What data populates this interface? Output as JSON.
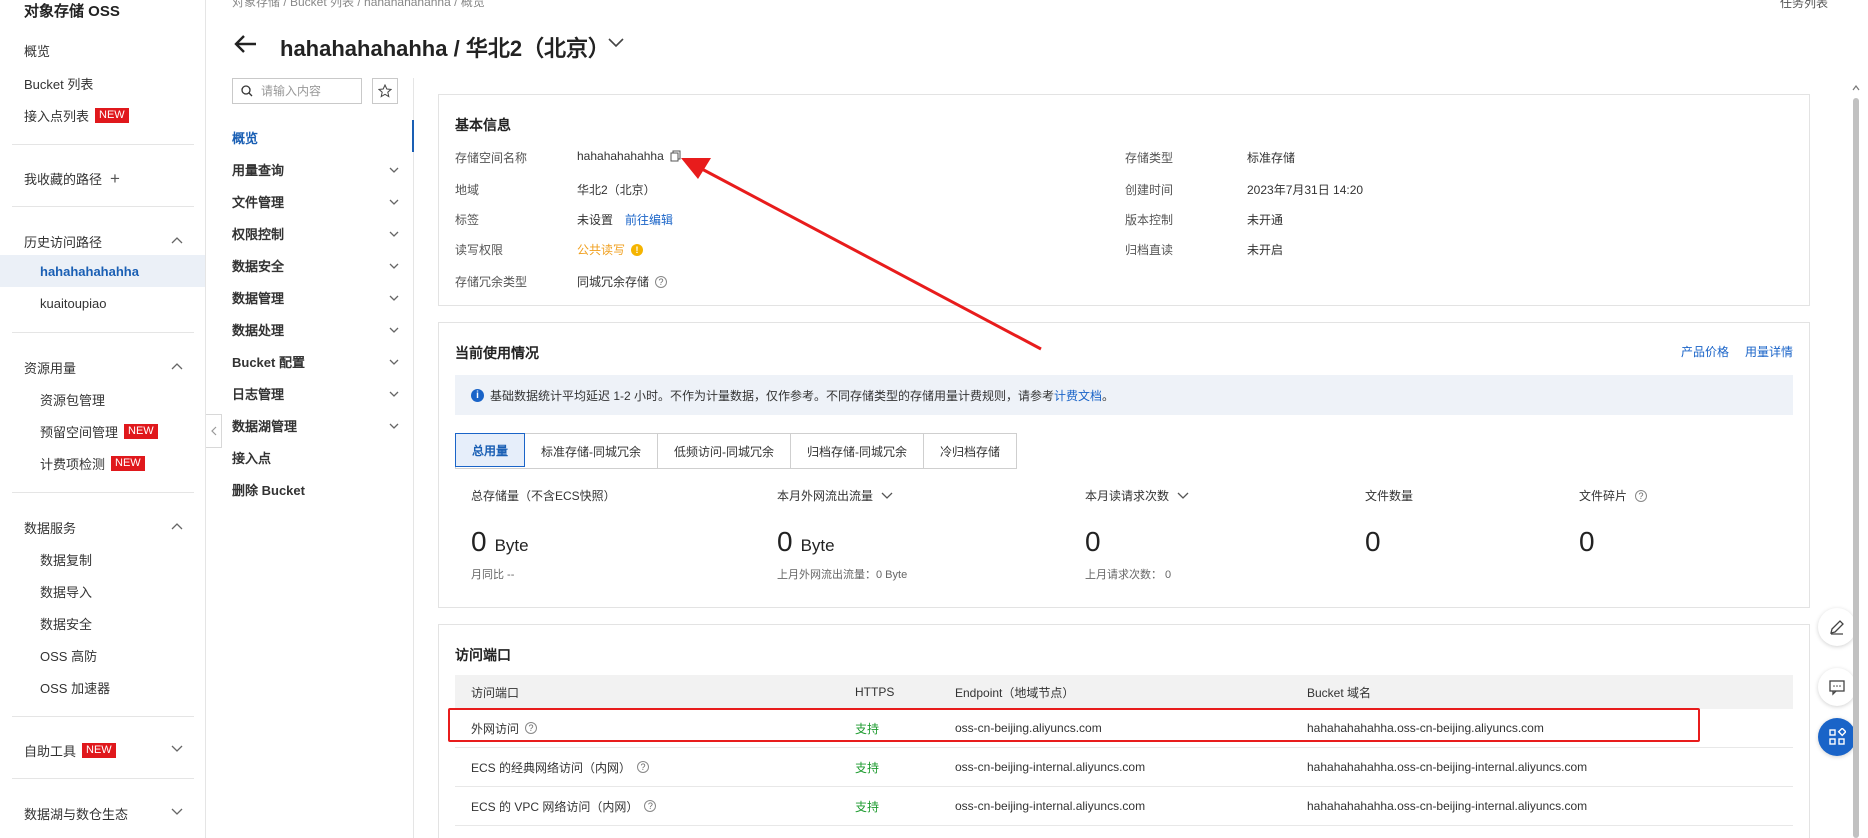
{
  "sidebar": {
    "title": "对象存储 OSS",
    "overview": "概览",
    "bucket_list": "Bucket 列表",
    "access_point_list": "接入点列表",
    "new_badge": "NEW",
    "favorites": "我收藏的路径",
    "history": {
      "label": "历史访问路径",
      "items": [
        "hahahahahahha",
        "kuaitoupiao"
      ]
    },
    "resource": {
      "label": "资源用量",
      "items": [
        "资源包管理",
        "预留空间管理",
        "计费项检测"
      ]
    },
    "data_services": {
      "label": "数据服务",
      "items": [
        "数据复制",
        "数据导入",
        "数据安全",
        "OSS 高防",
        "OSS 加速器"
      ]
    },
    "self_tools": "自助工具",
    "datalake": "数据湖与数仓生态"
  },
  "top": {
    "breadcrumb": "对象存储  /  Bucket 列表  /  hahahahahahha  /  概览",
    "right_link": "任务列表",
    "title": "hahahahahahha / 华北2（北京）"
  },
  "subnav": {
    "search_placeholder": "请输入内容",
    "items": [
      {
        "label": "概览"
      },
      {
        "label": "用量查询"
      },
      {
        "label": "文件管理"
      },
      {
        "label": "权限控制"
      },
      {
        "label": "数据安全"
      },
      {
        "label": "数据管理"
      },
      {
        "label": "数据处理"
      },
      {
        "label": "Bucket 配置"
      },
      {
        "label": "日志管理"
      },
      {
        "label": "数据湖管理"
      },
      {
        "label": "接入点"
      },
      {
        "label": "删除 Bucket"
      }
    ]
  },
  "basic_info": {
    "title": "基本信息",
    "bucket_name_label": "存储空间名称",
    "bucket_name": "hahahahahahha",
    "region_label": "地域",
    "region": "华北2（北京）",
    "tags_label": "标签",
    "tags_value": "未设置",
    "tags_edit": "前往编辑",
    "acl_label": "读写权限",
    "acl_value": "公共读写",
    "redundancy_label": "存储冗余类型",
    "redundancy_value": "同城冗余存储",
    "storage_class_label": "存储类型",
    "storage_class": "标准存储",
    "created_label": "创建时间",
    "created": "2023年7月31日 14:20",
    "versioning_label": "版本控制",
    "versioning": "未开通",
    "archive_label": "归档直读",
    "archive": "未开启"
  },
  "usage": {
    "title": "当前使用情况",
    "pricing_link": "产品价格",
    "detail_link": "用量详情",
    "notice": "基础数据统计平均延迟 1-2 小时。不作为计量数据，仅作参考。不同存储类型的存储用量计费规则，请参考",
    "notice_link": "计费文档",
    "notice_end": "。",
    "tabs": [
      "总用量",
      "标准存储-同城冗余",
      "低频访问-同城冗余",
      "归档存储-同城冗余",
      "冷归档存储"
    ],
    "stats": [
      {
        "label": "总存储量（不含ECS快照）",
        "value": "0",
        "unit": "Byte",
        "sub": "月同比  --"
      },
      {
        "label": "本月外网流出流量",
        "value": "0",
        "unit": "Byte",
        "sub": "上月外网流出流量：0 Byte"
      },
      {
        "label": "本月读请求次数",
        "value": "0",
        "unit": "",
        "sub": "上月请求次数：  0"
      },
      {
        "label": "文件数量",
        "value": "0",
        "unit": "",
        "sub": ""
      },
      {
        "label": "文件碎片",
        "value": "0",
        "unit": "",
        "sub": ""
      }
    ]
  },
  "endpoints": {
    "title": "访问端口",
    "headers": [
      "访问端口",
      "HTTPS",
      "Endpoint（地域节点）",
      "Bucket 域名"
    ],
    "rows": [
      {
        "name": "外网访问",
        "https": "支持",
        "endpoint": "oss-cn-beijing.aliyuncs.com",
        "domain": "hahahahahahha.oss-cn-beijing.aliyuncs.com"
      },
      {
        "name": "ECS 的经典网络访问（内网）",
        "https": "支持",
        "endpoint": "oss-cn-beijing-internal.aliyuncs.com",
        "domain": "hahahahahahha.oss-cn-beijing-internal.aliyuncs.com"
      },
      {
        "name": "ECS 的 VPC 网络访问（内网）",
        "https": "支持",
        "endpoint": "oss-cn-beijing-internal.aliyuncs.com",
        "domain": "hahahahahahha.oss-cn-beijing-internal.aliyuncs.com"
      }
    ]
  },
  "colors": {
    "accent": "#1a64c8",
    "annotation": "#e81c1c",
    "badge": "#e0181c",
    "success": "#1d9b2f",
    "warning": "#f0a020"
  },
  "icons": [
    "back-arrow-icon",
    "chevron-down-icon",
    "search-icon",
    "star-icon",
    "copy-icon",
    "question-icon",
    "info-icon",
    "warning-icon",
    "plus-icon",
    "chevron-up-icon",
    "edit-icon",
    "chat-icon",
    "apps-icon"
  ]
}
